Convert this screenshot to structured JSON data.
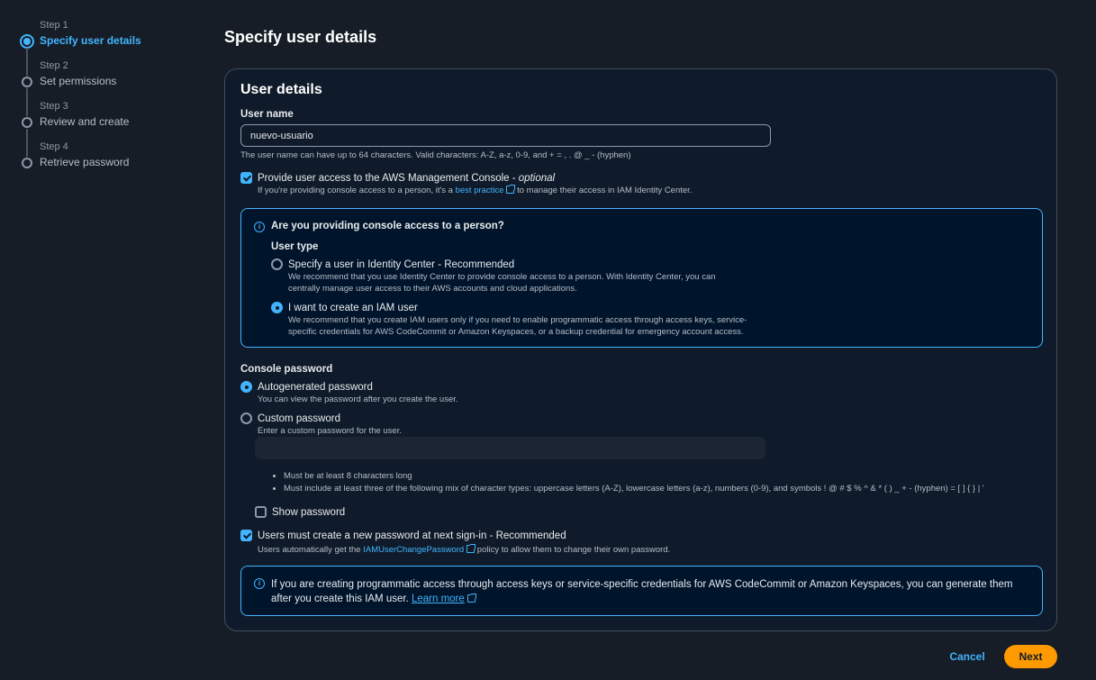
{
  "steps": [
    {
      "num": "Step 1",
      "label": "Specify user details",
      "active": true
    },
    {
      "num": "Step 2",
      "label": "Set permissions"
    },
    {
      "num": "Step 3",
      "label": "Review and create"
    },
    {
      "num": "Step 4",
      "label": "Retrieve password"
    }
  ],
  "page_title": "Specify user details",
  "user_details": {
    "title": "User details",
    "username_label": "User name",
    "username_value": "nuevo-usuario",
    "username_hint": "The user name can have up to 64 characters. Valid characters: A-Z, a-z, 0-9, and + = , . @ _ - (hyphen)",
    "console_access_label": "Provide user access to the AWS Management Console - ",
    "console_access_optional": "optional",
    "console_access_hint_pre": "If you're providing console access to a person, it's a ",
    "console_access_hint_link": "best practice",
    "console_access_hint_post": " to manage their access in IAM Identity Center."
  },
  "person_box": {
    "title": "Are you providing console access to a person?",
    "user_type_label": "User type",
    "option1_label": "Specify a user in Identity Center - Recommended",
    "option1_desc": "We recommend that you use Identity Center to provide console access to a person. With Identity Center, you can centrally manage user access to their AWS accounts and cloud applications.",
    "option2_label": "I want to create an IAM user",
    "option2_desc": "We recommend that you create IAM users only if you need to enable programmatic access through access keys, service-specific credentials for AWS CodeCommit or Amazon Keyspaces, or a backup credential for emergency account access."
  },
  "password": {
    "label": "Console password",
    "auto_label": "Autogenerated password",
    "auto_hint": "You can view the password after you create the user.",
    "custom_label": "Custom password",
    "custom_hint": "Enter a custom password for the user.",
    "rule1": "Must be at least 8 characters long",
    "rule2": "Must include at least three of the following mix of character types: uppercase letters (A-Z), lowercase letters (a-z), numbers (0-9), and symbols ! @ # $ % ^ & * ( ) _ + - (hyphen) = [ ] { } | '",
    "show_label": "Show password",
    "reset_label": "Users must create a new password at next sign-in - Recommended",
    "reset_hint_pre": "Users automatically get the ",
    "reset_hint_link": "IAMUserChangePassword",
    "reset_hint_post": " policy to allow them to change their own password."
  },
  "programmatic_box": {
    "text": "If you are creating programmatic access through access keys or service-specific credentials for AWS CodeCommit or Amazon Keyspaces, you can generate them after you create this IAM user. ",
    "link": "Learn more"
  },
  "footer": {
    "cancel": "Cancel",
    "next": "Next"
  },
  "colors": {
    "accent": "#42b4ff",
    "primary_button": "#ff9900",
    "background": "#161d26"
  }
}
